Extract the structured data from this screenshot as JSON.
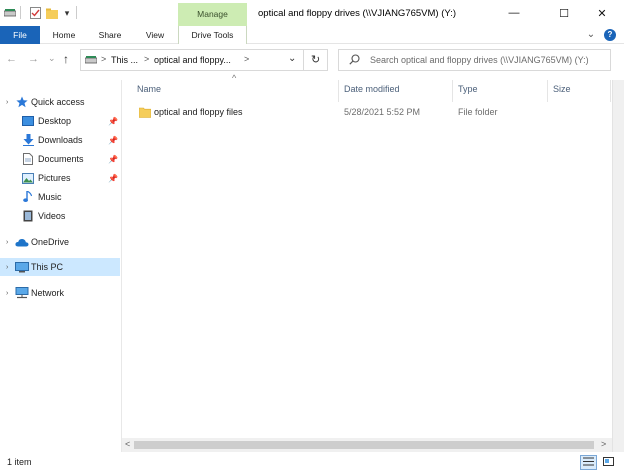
{
  "window": {
    "title": "optical and floppy drives (\\\\VJIANG765VM) (Y:)",
    "controls": {
      "minimize": "—",
      "maximize": "☐",
      "close": "✕"
    }
  },
  "quick_access_toolbar": {
    "dropdown": "▾"
  },
  "ribbon": {
    "context_group": "Manage",
    "tabs": [
      "File",
      "Home",
      "Share",
      "View",
      "Drive Tools"
    ],
    "collapse_glyph": "⌄",
    "help_glyph": "?"
  },
  "nav": {
    "back": "←",
    "forward": "→",
    "history": "⌄",
    "up": "↑"
  },
  "address": {
    "crumbs": [
      "This ...",
      "optical and floppy..."
    ],
    "separator": ">",
    "dropdown": "⌄",
    "refresh": "↻"
  },
  "search": {
    "placeholder": "Search optical and floppy drives (\\\\VJIANG765VM) (Y:)"
  },
  "sidebar": {
    "items": [
      {
        "label": "Quick access",
        "icon": "star-icon",
        "pinned": false,
        "selected": false
      },
      {
        "label": "Desktop",
        "icon": "desktop-icon",
        "pinned": true,
        "selected": false
      },
      {
        "label": "Downloads",
        "icon": "download-icon",
        "pinned": true,
        "selected": false
      },
      {
        "label": "Documents",
        "icon": "document-icon",
        "pinned": true,
        "selected": false
      },
      {
        "label": "Pictures",
        "icon": "picture-icon",
        "pinned": true,
        "selected": false
      },
      {
        "label": "Music",
        "icon": "music-icon",
        "pinned": false,
        "selected": false
      },
      {
        "label": "Videos",
        "icon": "video-icon",
        "pinned": false,
        "selected": false
      },
      {
        "label": "OneDrive",
        "icon": "cloud-icon",
        "pinned": false,
        "selected": false
      },
      {
        "label": "This PC",
        "icon": "computer-icon",
        "pinned": false,
        "selected": true
      },
      {
        "label": "Network",
        "icon": "network-icon",
        "pinned": false,
        "selected": false
      }
    ]
  },
  "columns": {
    "name": "Name",
    "date": "Date modified",
    "type": "Type",
    "size": "Size",
    "sort_glyph": "^"
  },
  "files": [
    {
      "name": "optical and floppy files",
      "date": "5/28/2021 5:52 PM",
      "type": "File folder",
      "size": ""
    }
  ],
  "scroll": {
    "left": "<",
    "right": ">"
  },
  "status": {
    "count": "1 item"
  },
  "colors": {
    "accent": "#1a64b8",
    "manage": "#cdecb3",
    "selection": "#cce8ff",
    "folder": "#f5cd5a"
  }
}
